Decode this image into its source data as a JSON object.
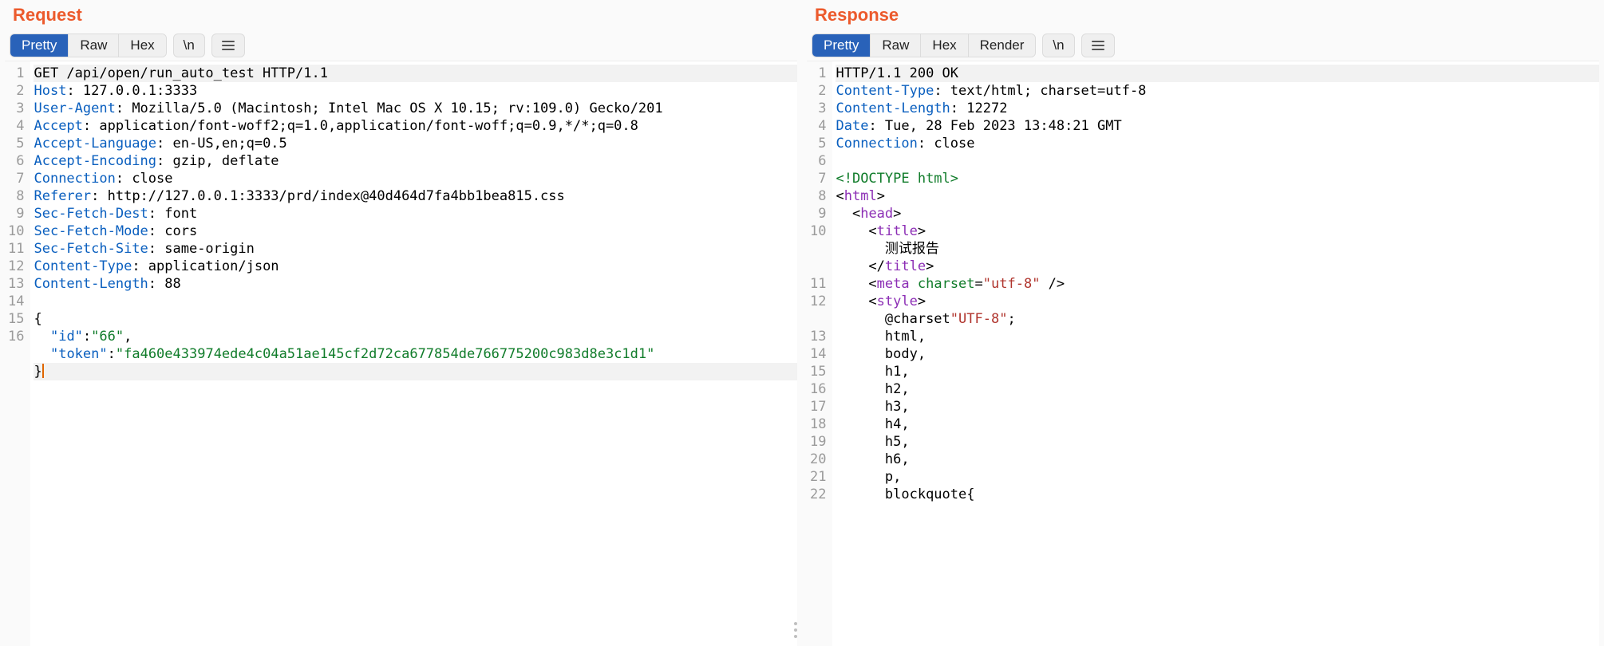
{
  "request": {
    "title": "Request",
    "tabs": [
      "Pretty",
      "Raw",
      "Hex"
    ],
    "active_tab": "Pretty",
    "newline_label": "\\n",
    "lines": [
      {
        "n": 1,
        "hl": true,
        "segs": [
          [
            "p",
            "GET /api/open/run_auto_test HTTP/1.1"
          ]
        ]
      },
      {
        "n": 2,
        "segs": [
          [
            "h",
            "Host"
          ],
          [
            "p",
            ": 127.0.0.1:3333"
          ]
        ]
      },
      {
        "n": 3,
        "segs": [
          [
            "h",
            "User-Agent"
          ],
          [
            "p",
            ": Mozilla/5.0 (Macintosh; Intel Mac OS X 10.15; rv:109.0) Gecko/201"
          ]
        ]
      },
      {
        "n": 4,
        "segs": [
          [
            "h",
            "Accept"
          ],
          [
            "p",
            ": application/font-woff2;q=1.0,application/font-woff;q=0.9,*/*;q=0.8"
          ]
        ]
      },
      {
        "n": 5,
        "segs": [
          [
            "h",
            "Accept-Language"
          ],
          [
            "p",
            ": en-US,en;q=0.5"
          ]
        ]
      },
      {
        "n": 6,
        "segs": [
          [
            "h",
            "Accept-Encoding"
          ],
          [
            "p",
            ": gzip, deflate"
          ]
        ]
      },
      {
        "n": 7,
        "segs": [
          [
            "h",
            "Connection"
          ],
          [
            "p",
            ": close"
          ]
        ]
      },
      {
        "n": 8,
        "segs": [
          [
            "h",
            "Referer"
          ],
          [
            "p",
            ": http://127.0.0.1:3333/prd/index@40d464d7fa4bb1bea815.css"
          ]
        ]
      },
      {
        "n": 9,
        "segs": [
          [
            "h",
            "Sec-Fetch-Dest"
          ],
          [
            "p",
            ": font"
          ]
        ]
      },
      {
        "n": 10,
        "segs": [
          [
            "h",
            "Sec-Fetch-Mode"
          ],
          [
            "p",
            ": cors"
          ]
        ]
      },
      {
        "n": 11,
        "segs": [
          [
            "h",
            "Sec-Fetch-Site"
          ],
          [
            "p",
            ": same-origin"
          ]
        ]
      },
      {
        "n": 12,
        "segs": [
          [
            "h",
            "Content-Type"
          ],
          [
            "p",
            ": application/json"
          ]
        ]
      },
      {
        "n": 13,
        "segs": [
          [
            "h",
            "Content-Length"
          ],
          [
            "p",
            ": 88"
          ]
        ]
      },
      {
        "n": 14,
        "segs": [
          [
            "p",
            ""
          ]
        ]
      },
      {
        "n": 15,
        "segs": [
          [
            "p",
            "{"
          ]
        ]
      },
      {
        "n": 16,
        "segs": [
          [
            "p",
            "  "
          ],
          [
            "h",
            "\"id\""
          ],
          [
            "p",
            ":"
          ],
          [
            "v",
            "\"66\""
          ],
          [
            "p",
            ","
          ]
        ]
      },
      {
        "n": null,
        "segs": [
          [
            "p",
            "  "
          ],
          [
            "h",
            "\"token\""
          ],
          [
            "p",
            ":"
          ],
          [
            "v",
            "\"fa460e433974ede4c04a51ae145cf2d72ca677854de766775200c983d8e3c1d1\""
          ]
        ]
      },
      {
        "n": null,
        "hl": true,
        "segs": [
          [
            "p",
            "}"
          ],
          [
            "cur"
          ]
        ]
      }
    ]
  },
  "response": {
    "title": "Response",
    "tabs": [
      "Pretty",
      "Raw",
      "Hex",
      "Render"
    ],
    "active_tab": "Pretty",
    "newline_label": "\\n",
    "lines": [
      {
        "n": 1,
        "hl": true,
        "segs": [
          [
            "p",
            "HTTP/1.1 200 OK"
          ]
        ]
      },
      {
        "n": 2,
        "segs": [
          [
            "h",
            "Content-Type"
          ],
          [
            "p",
            ": text/html; charset=utf-8"
          ]
        ]
      },
      {
        "n": 3,
        "segs": [
          [
            "h",
            "Content-Length"
          ],
          [
            "p",
            ": 12272"
          ]
        ]
      },
      {
        "n": 4,
        "segs": [
          [
            "h",
            "Date"
          ],
          [
            "p",
            ": Tue, 28 Feb 2023 13:48:21 GMT"
          ]
        ]
      },
      {
        "n": 5,
        "segs": [
          [
            "h",
            "Connection"
          ],
          [
            "p",
            ": close"
          ]
        ]
      },
      {
        "n": 6,
        "segs": [
          [
            "p",
            ""
          ]
        ]
      },
      {
        "n": 7,
        "segs": [
          [
            "v",
            "<!DOCTYPE html>"
          ]
        ]
      },
      {
        "n": 8,
        "segs": [
          [
            "p",
            "<"
          ],
          [
            "l",
            "html"
          ],
          [
            "p",
            ">"
          ]
        ]
      },
      {
        "n": 9,
        "segs": [
          [
            "p",
            "  <"
          ],
          [
            "l",
            "head"
          ],
          [
            "p",
            ">"
          ]
        ]
      },
      {
        "n": 10,
        "segs": [
          [
            "p",
            "    <"
          ],
          [
            "l",
            "title"
          ],
          [
            "p",
            ">"
          ]
        ]
      },
      {
        "n": null,
        "segs": [
          [
            "p",
            "      测试报告"
          ]
        ]
      },
      {
        "n": null,
        "segs": [
          [
            "p",
            "    </"
          ],
          [
            "l",
            "title"
          ],
          [
            "p",
            ">"
          ]
        ]
      },
      {
        "n": 11,
        "segs": [
          [
            "p",
            "    <"
          ],
          [
            "l",
            "meta"
          ],
          [
            "p",
            " "
          ],
          [
            "a",
            "charset"
          ],
          [
            "p",
            "="
          ],
          [
            "s",
            "\"utf-8\""
          ],
          [
            "p",
            " />"
          ]
        ]
      },
      {
        "n": 12,
        "segs": [
          [
            "p",
            "    <"
          ],
          [
            "l",
            "style"
          ],
          [
            "p",
            ">"
          ]
        ]
      },
      {
        "n": null,
        "segs": [
          [
            "p",
            "      @charset"
          ],
          [
            "s",
            "\"UTF-8\""
          ],
          [
            "p",
            ";"
          ]
        ]
      },
      {
        "n": 13,
        "segs": [
          [
            "p",
            "      html,"
          ]
        ]
      },
      {
        "n": 14,
        "segs": [
          [
            "p",
            "      body,"
          ]
        ]
      },
      {
        "n": 15,
        "segs": [
          [
            "p",
            "      h1,"
          ]
        ]
      },
      {
        "n": 16,
        "segs": [
          [
            "p",
            "      h2,"
          ]
        ]
      },
      {
        "n": 17,
        "segs": [
          [
            "p",
            "      h3,"
          ]
        ]
      },
      {
        "n": 18,
        "segs": [
          [
            "p",
            "      h4,"
          ]
        ]
      },
      {
        "n": 19,
        "segs": [
          [
            "p",
            "      h5,"
          ]
        ]
      },
      {
        "n": 20,
        "segs": [
          [
            "p",
            "      h6,"
          ]
        ]
      },
      {
        "n": 21,
        "segs": [
          [
            "p",
            "      p,"
          ]
        ]
      },
      {
        "n": 22,
        "segs": [
          [
            "p",
            "      blockquote{"
          ]
        ]
      }
    ]
  }
}
